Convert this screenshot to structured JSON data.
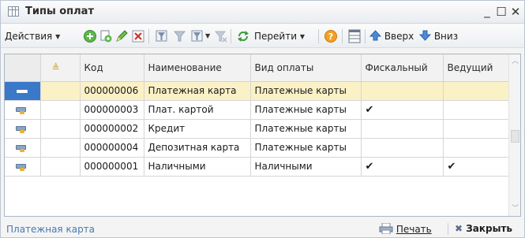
{
  "window": {
    "title": "Типы оплат",
    "minimize": "_",
    "maximize": "☐",
    "close": "✕"
  },
  "toolbar": {
    "actions_label": "Действия",
    "goto_label": "Перейти",
    "up_label": "Вверх",
    "down_label": "Вниз",
    "help_label": "?",
    "icons": [
      "add-circle-icon",
      "copy-icon",
      "edit-pencil-icon",
      "delete-icon",
      "filter-set-icon",
      "filter-icon",
      "filter-list-icon",
      "filter-clear-icon",
      "refresh-icon",
      "help-icon",
      "columns-icon",
      "arrow-up-icon",
      "arrow-down-icon"
    ]
  },
  "table": {
    "columns": [
      "Код",
      "Наименование",
      "Вид оплаты",
      "Фискальный",
      "Ведущий"
    ],
    "rows": [
      {
        "code": "000000006",
        "name": "Платежная карта",
        "type": "Платежные карты",
        "fiscal": "",
        "leading": ""
      },
      {
        "code": "000000003",
        "name": "Плат. картой",
        "type": "Платежные карты",
        "fiscal": "✔",
        "leading": ""
      },
      {
        "code": "000000002",
        "name": "Кредит",
        "type": "Платежные карты",
        "fiscal": "",
        "leading": ""
      },
      {
        "code": "000000004",
        "name": "Депозитная карта",
        "type": "Платежные карты",
        "fiscal": "",
        "leading": ""
      },
      {
        "code": "000000001",
        "name": "Наличными",
        "type": "Наличными",
        "fiscal": "✔",
        "leading": "✔"
      }
    ]
  },
  "statusbar": {
    "current": "Платежная карта",
    "print_label": "Печать",
    "close_label": "Закрыть"
  },
  "colors": {
    "selection_row": "#fbf1c6",
    "selection_marker": "#3a78c8",
    "status_text": "#4a78b0"
  }
}
